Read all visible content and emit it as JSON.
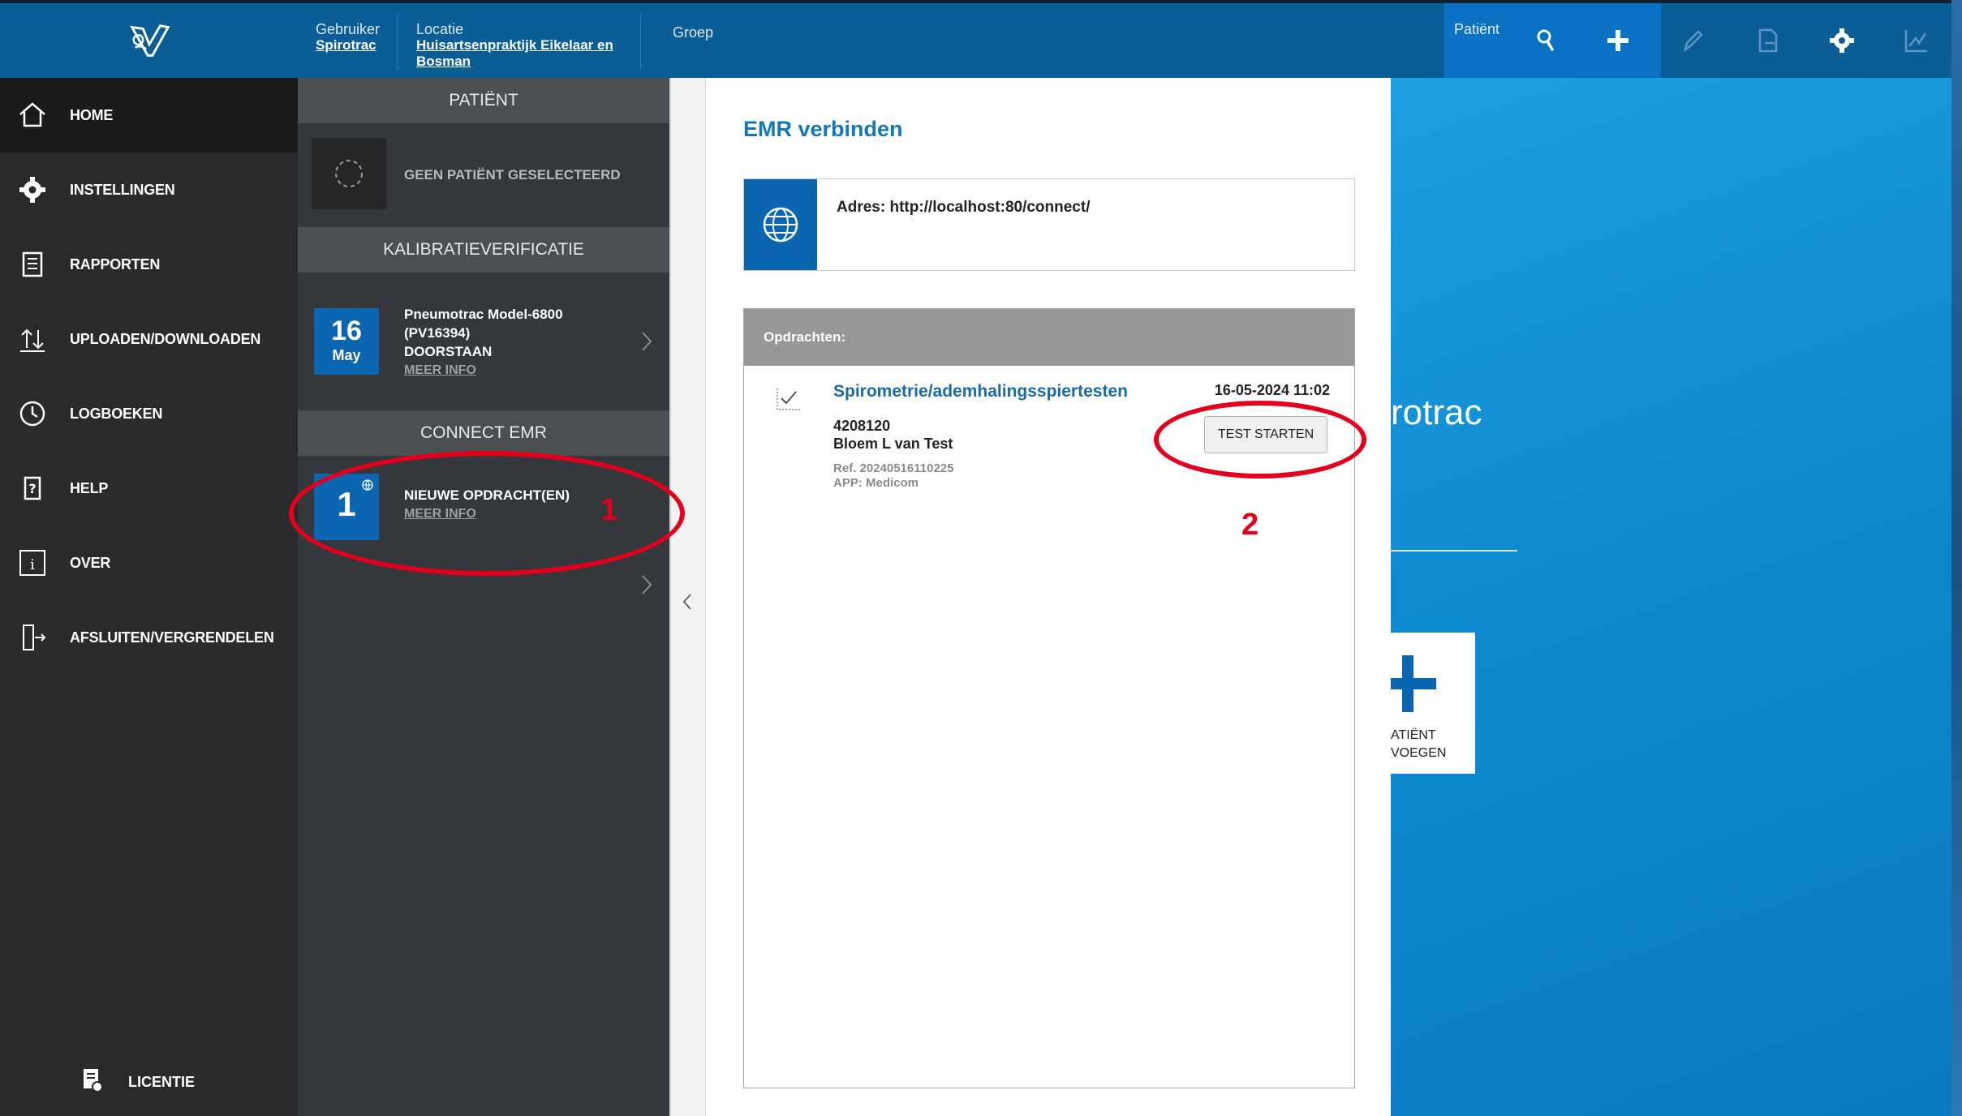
{
  "header": {
    "user_label": "Gebruiker",
    "user_value": "Spirotrac",
    "location_label": "Locatie",
    "location_value_line1": "Huisartsenpraktijk Eikelaar en",
    "location_value_line2": "Bosman",
    "group_label": "Groep",
    "patient_label": "Patiënt",
    "icons": [
      "search-icon",
      "plus-icon",
      "pen-icon",
      "document-icon",
      "gear-icon",
      "chart-icon"
    ]
  },
  "nav": {
    "items": [
      {
        "label": "HOME",
        "icon": "home-icon"
      },
      {
        "label": "INSTELLINGEN",
        "icon": "gear-icon"
      },
      {
        "label": "RAPPORTEN",
        "icon": "report-icon"
      },
      {
        "label": "UPLOADEN/DOWNLOADEN",
        "icon": "upload-download-icon"
      },
      {
        "label": "LOGBOEKEN",
        "icon": "clock-icon"
      },
      {
        "label": "HELP",
        "icon": "help-icon"
      },
      {
        "label": "OVER",
        "icon": "info-icon"
      },
      {
        "label": "AFSLUITEN/VERGRENDELEN",
        "icon": "exit-icon"
      }
    ],
    "license_label": "LICENTIE"
  },
  "panel": {
    "patient_header": "PATIËNT",
    "no_patient": "GEEN PATIËNT GESELECTEERD",
    "calibration_header": "KALIBRATIEVERIFICATIE",
    "calibration": {
      "day": "16",
      "month": "May",
      "device_line1": "Pneumotrac Model-6800",
      "device_line2": "(PV16394)",
      "status": "DOORSTAAN",
      "more": "MEER INFO"
    },
    "emr_header": "CONNECT EMR",
    "emr": {
      "count": "1",
      "label": "NIEUWE OPDRACHT(EN)",
      "more": "MEER INFO"
    }
  },
  "dialog": {
    "title": "EMR verbinden",
    "address": "Adres: http://localhost:80/connect/",
    "tasks_header": "Opdrachten:",
    "task": {
      "title": "Spirometrie/ademhalingsspiertesten",
      "datetime": "16-05-2024 11:02",
      "patient_id": "4208120",
      "patient_name": "Bloem L van Test",
      "ref": "Ref. 20240516110225",
      "app": "APP: Medicom",
      "button": "TEST STARTEN"
    }
  },
  "background": {
    "brand_fragment": "rotrac",
    "add_patient_label": "ATIËNT\nVOEGEN"
  },
  "annotations": {
    "label_1": "1",
    "label_2": "2"
  },
  "colors": {
    "topbar": "#0b5d96",
    "accent_blue": "#0a66b0",
    "nav_bg": "#2a2a2c",
    "panel_bg": "#34373c",
    "annotation_red": "#e3001b"
  }
}
